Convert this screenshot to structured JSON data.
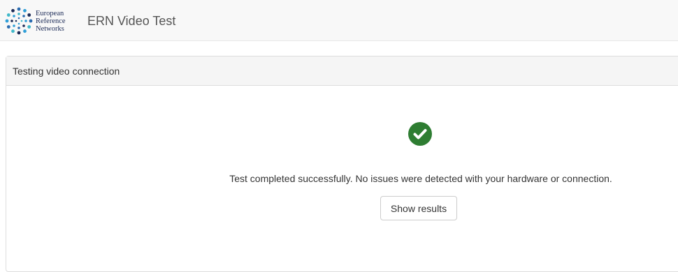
{
  "header": {
    "logo": {
      "icon": "ern-dots-logo",
      "lines": [
        "European",
        "Reference",
        "Networks"
      ]
    },
    "title": "ERN Video Test"
  },
  "panel": {
    "heading": "Testing video connection",
    "status_icon": "check-circle-icon",
    "status_color": "#2e7d32",
    "message": "Test completed successfully. No issues were detected with your hardware or connection.",
    "button_label": "Show results"
  }
}
